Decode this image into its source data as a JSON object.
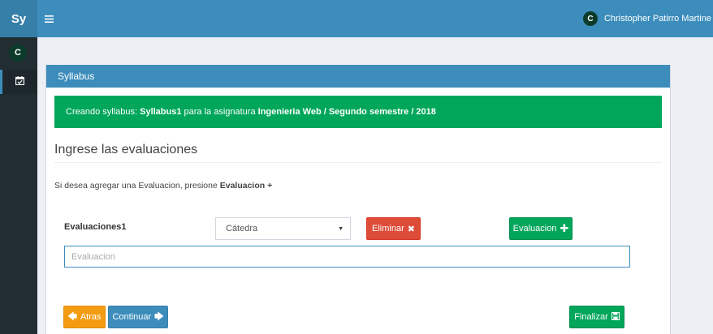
{
  "app": {
    "logo": "Sy",
    "menu_icon": "hamburger-icon"
  },
  "user": {
    "initial": "C",
    "name": "Christopher Patirro Martine"
  },
  "sidebar": {
    "avatar_initial": "C",
    "items": [
      {
        "icon": "calendar-check-icon"
      }
    ]
  },
  "box": {
    "title": "Syllabus",
    "alert": {
      "prefix": "Creando syllabus: ",
      "syllabus_name": "Syllabus1",
      "middle": " para la asignatura ",
      "course": "Ingenieria Web / Segundo semestre / 2018"
    },
    "section_title": "Ingrese las evaluaciones",
    "help_text": "Si desea agregar una Evaluacion, presione ",
    "help_button_ref": "Evaluacion +",
    "form": {
      "label": "Evaluaciones1",
      "select_value": "Cátedra",
      "delete_label": "Eliminar",
      "add_label": "Evaluacion",
      "input_placeholder": "Evaluacion"
    },
    "footer": {
      "back_label": "Atras",
      "continue_label": "Continuar",
      "finish_label": "Finalizar"
    }
  },
  "colors": {
    "primary": "#3c8dbc",
    "success": "#00a65a",
    "danger": "#dd4b39",
    "warning": "#f39c12",
    "sidebar": "#222d32"
  }
}
